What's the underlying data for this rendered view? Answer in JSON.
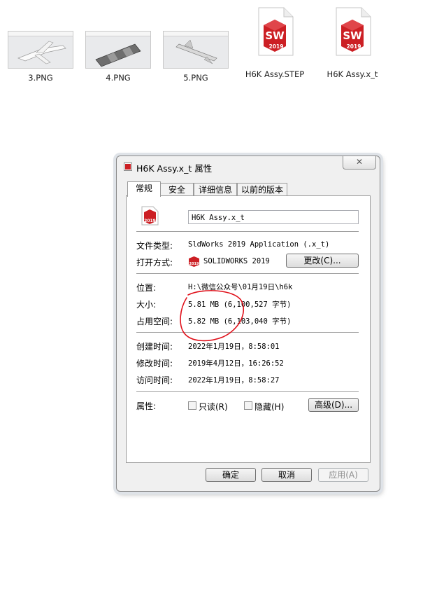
{
  "desktop": {
    "files": [
      {
        "name": "3.PNG",
        "type": "png-thumbnail-aircraft"
      },
      {
        "name": "4.PNG",
        "type": "png-thumbnail-cylinder"
      },
      {
        "name": "5.PNG",
        "type": "png-thumbnail-missile"
      },
      {
        "name": "H6K Assy.STEP",
        "type": "solidworks-2019-icon"
      },
      {
        "name": "H6K Assy.x_t",
        "type": "solidworks-2019-icon"
      }
    ],
    "icon_badge": "SW",
    "icon_year": "2019"
  },
  "dialog": {
    "title": "H6K Assy.x_t 属性",
    "close_symbol": "✕",
    "tabs": [
      "常规",
      "安全",
      "详细信息",
      "以前的版本"
    ],
    "active_tab": 0,
    "general": {
      "file_name": "H6K Assy.x_t",
      "file_type_label": "文件类型:",
      "file_type_value": "SldWorks 2019 Application (.x_t)",
      "open_with_label": "打开方式:",
      "open_with_value": "SOLIDWORKS 2019",
      "change_button": "更改(C)...",
      "location_label": "位置:",
      "location_value": "H:\\微信公众号\\01月19日\\h6k",
      "size_label": "大小:",
      "size_value": "5.81 MB (6,100,527 字节)",
      "disk_size_label": "占用空间:",
      "disk_size_value": "5.82 MB (6,103,040 字节)",
      "created_label": "创建时间:",
      "created_value": "2022年1月19日，8:58:01",
      "modified_label": "修改时间:",
      "modified_value": "2019年4月12日，16:26:52",
      "accessed_label": "访问时间:",
      "accessed_value": "2022年1月19日，8:58:27",
      "attributes_label": "属性:",
      "readonly_label": "只读(R)",
      "hidden_label": "隐藏(H)",
      "advanced_button": "高级(D)..."
    },
    "buttons": {
      "ok": "确定",
      "cancel": "取消",
      "apply": "应用(A)"
    }
  },
  "colors": {
    "sw_red": "#cc1f24",
    "annotation_red": "#e0101a",
    "dialog_bg": "#f0f0f0"
  }
}
